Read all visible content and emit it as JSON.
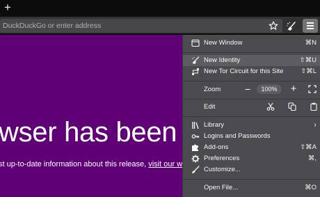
{
  "tabstrip": {
    "new_tab_symbol": "+"
  },
  "urlbar": {
    "placeholder": "DuckDuckGo or enter address"
  },
  "page": {
    "headline": "wser has been upd",
    "subtext_prefix": "st up-to-date information about this release, ",
    "subtext_link": "visit our webs"
  },
  "menu": {
    "new_window": {
      "label": "New Window",
      "shortcut": "⌘N",
      "icon": "window-icon"
    },
    "new_identity": {
      "label": "New Identity",
      "shortcut": "⇧⌘U",
      "icon": "broom-icon"
    },
    "new_circuit": {
      "label": "New Tor Circuit for this Site",
      "shortcut": "⇧⌘L",
      "icon": "circuit-icon"
    },
    "zoom": {
      "label": "Zoom",
      "minus": "−",
      "value": "100%",
      "plus": "+"
    },
    "edit": {
      "label": "Edit"
    },
    "library": {
      "label": "Library",
      "chevron": "›"
    },
    "logins": {
      "label": "Logins and Passwords"
    },
    "addons": {
      "label": "Add-ons",
      "shortcut": "⇧⌘A"
    },
    "preferences": {
      "label": "Preferences",
      "shortcut": "⌘,"
    },
    "customize": {
      "label": "Customize..."
    },
    "open_file": {
      "label": "Open File...",
      "shortcut": "⌘O"
    }
  },
  "colors": {
    "page_bg": "#5f0077",
    "menu_bg": "#4a4a4f",
    "menu_highlight": "#5c5c61",
    "toolbar_bg": "#323234"
  }
}
